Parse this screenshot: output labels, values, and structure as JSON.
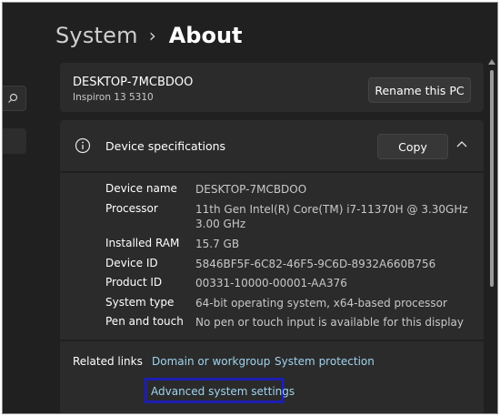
{
  "header": {
    "parent": "System",
    "separator": "›",
    "current": "About"
  },
  "device": {
    "name": "DESKTOP-7MCBDOO",
    "model": "Inspiron 13 5310",
    "rename_label": "Rename this PC"
  },
  "specs": {
    "title": "Device specifications",
    "copy_label": "Copy",
    "expanded": true,
    "rows": [
      {
        "label": "Device name",
        "value": "DESKTOP-7MCBDOO"
      },
      {
        "label": "Processor",
        "value": "11th Gen Intel(R) Core(TM) i7-11370H @ 3.30GHz",
        "value2": "3.00 GHz"
      },
      {
        "label": "Installed RAM",
        "value": "15.7 GB"
      },
      {
        "label": "Device ID",
        "value": "5846BF5F-6C82-46F5-9C6D-8932A660B756"
      },
      {
        "label": "Product ID",
        "value": "00331-10000-00001-AA376"
      },
      {
        "label": "System type",
        "value": "64-bit operating system, x64-based processor"
      },
      {
        "label": "Pen and touch",
        "value": "No pen or touch input is available for this display"
      }
    ]
  },
  "related": {
    "label": "Related links",
    "links": [
      "Domain or workgroup",
      "System protection",
      "Advanced system settings"
    ],
    "highlighted": "Advanced system settings"
  },
  "colors": {
    "background": "#202020",
    "card": "#2b2b2b",
    "link": "#9fd3ee",
    "highlight_box": "#1e1eb4"
  },
  "icons": [
    "search-icon",
    "info-icon",
    "chevron-up-icon",
    "scroll-up-icon"
  ]
}
